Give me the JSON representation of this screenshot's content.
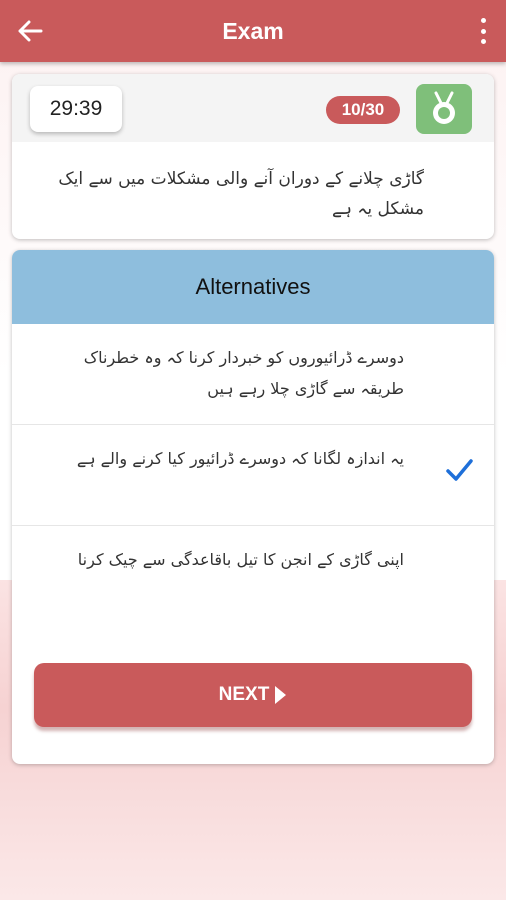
{
  "appbar": {
    "title": "Exam",
    "back_icon": "arrow-left-icon",
    "menu_icon": "more-vertical-icon",
    "color": "#c95a5b"
  },
  "question": {
    "timer": "29:39",
    "counter": "10/30",
    "badge_icon": "medal-icon",
    "text": "گاڑی چلانے کے دوران آنے والی مشکلات میں سے ایک مشکل یہ ہے"
  },
  "alternatives": {
    "header": "Alternatives",
    "header_color": "#8ebedd",
    "options": [
      {
        "text": "دوسرے ڈرائیوروں کو خبردار کرنا کہ وہ خطرناک طریقہ سے گاڑی چلا رہے ہیں",
        "selected": false
      },
      {
        "text": "یہ اندازہ لگانا کہ دوسرے ڈرائیور کیا کرنے والے ہے",
        "selected": true
      },
      {
        "text": "اپنی گاڑی کے انجن کا تیل باقاعدگی سے چیک کرنا",
        "selected": false
      }
    ],
    "check_icon": "check-icon",
    "check_color": "#1e6fd9"
  },
  "next_button": {
    "label": "NEXT",
    "icon": "play-icon"
  }
}
